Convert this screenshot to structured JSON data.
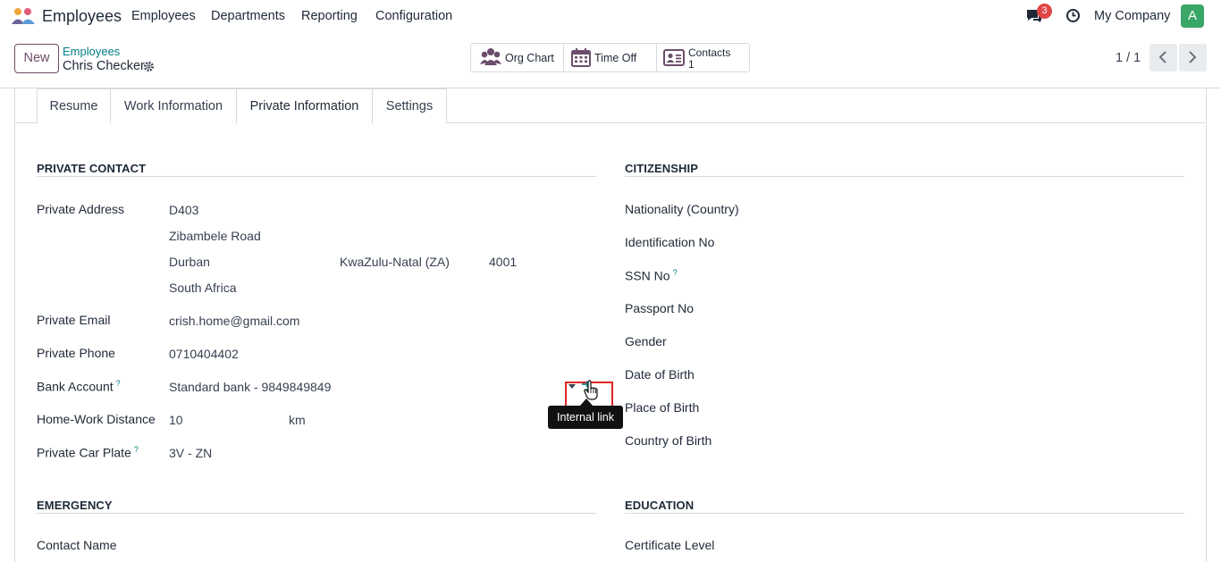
{
  "navbar": {
    "app_name": "Employees",
    "menu": [
      "Employees",
      "Departments",
      "Reporting",
      "Configuration"
    ],
    "chat_badge": "3",
    "company": "My Company",
    "avatar_letter": "A",
    "avatar_color": "#3aa667"
  },
  "control": {
    "new_label": "New",
    "breadcrumb_parent": "Employees",
    "breadcrumb_current": "Chris Checker",
    "smart_buttons": [
      {
        "label": "Org Chart",
        "icon": "org-chart-icon"
      },
      {
        "label": "Time Off",
        "icon": "calendar-icon"
      },
      {
        "label": "Contacts",
        "count": "1",
        "icon": "contact-card-icon"
      }
    ],
    "pager": "1 / 1"
  },
  "tabs": [
    "Resume",
    "Work Information",
    "Private Information",
    "Settings"
  ],
  "active_tab": "Private Information",
  "private_contact": {
    "title": "PRIVATE CONTACT",
    "address_label": "Private Address",
    "street": "D403",
    "street2": "Zibambele Road",
    "city": "Durban",
    "state": "KwaZulu-Natal (ZA)",
    "zip": "4001",
    "country": "South Africa",
    "email_label": "Private Email",
    "email": "crish.home@gmail.com",
    "phone_label": "Private Phone",
    "phone": "0710404402",
    "bank_label": "Bank Account",
    "bank": "Standard bank - 9849849849",
    "distance_label": "Home-Work Distance",
    "distance": "10",
    "distance_unit": "km",
    "plate_label": "Private Car Plate",
    "plate": "3V - ZN"
  },
  "citizenship": {
    "title": "CITIZENSHIP",
    "labels": [
      "Nationality (Country)",
      "Identification No",
      "SSN No",
      "Passport No",
      "Gender",
      "Date of Birth",
      "Place of Birth",
      "Country of Birth"
    ]
  },
  "emergency": {
    "title": "EMERGENCY",
    "contact_label": "Contact Name"
  },
  "education": {
    "title": "EDUCATION",
    "certificate_label": "Certificate Level"
  },
  "help_mark": "?",
  "tooltip": "Internal link",
  "colors": {
    "accent": "#714b67",
    "link": "#017e84",
    "badge": "#e04545",
    "highlight": "#e02424"
  }
}
